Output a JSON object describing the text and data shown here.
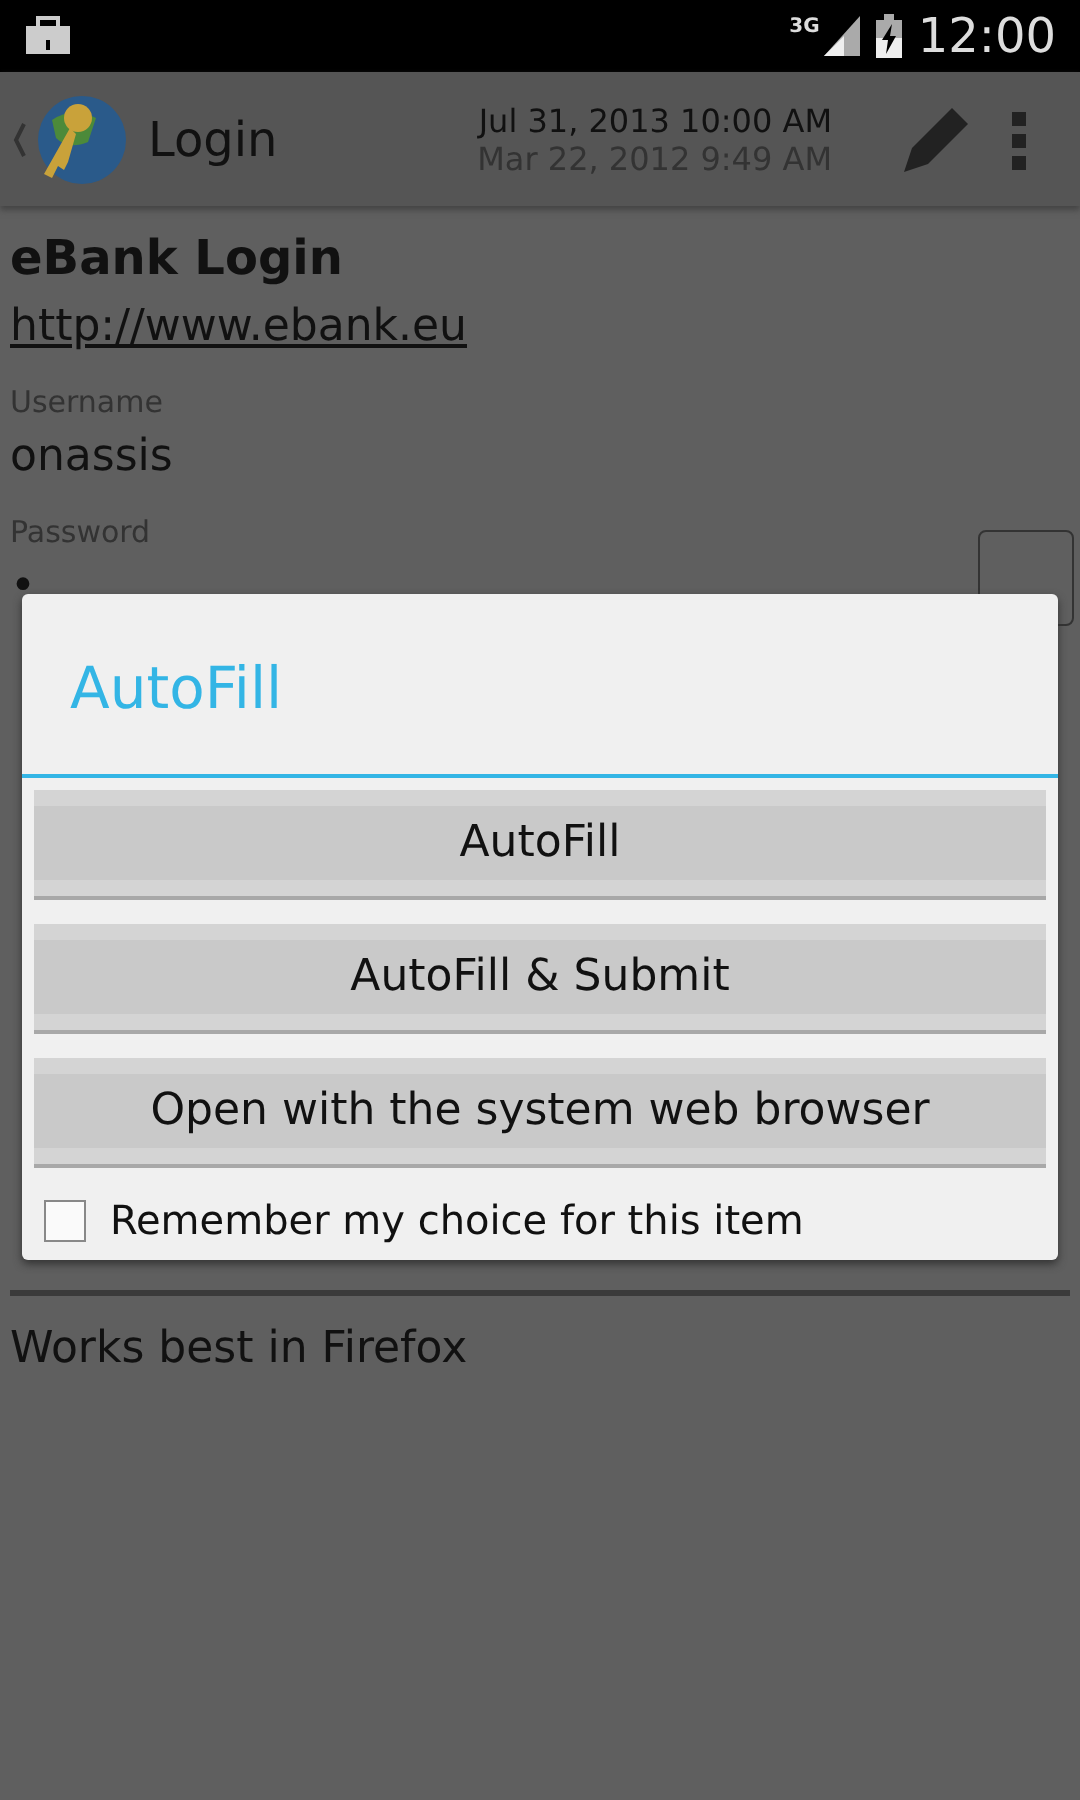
{
  "status_bar": {
    "time": "12:00",
    "network": "3G"
  },
  "action_bar": {
    "title": "Login",
    "modified": "Jul 31, 2013 10:00 AM",
    "created": "Mar 22, 2012 9:49 AM"
  },
  "entry": {
    "title": "eBank Login",
    "url": "http://www.ebank.eu",
    "fields": [
      {
        "label": "Username",
        "value": "onassis"
      },
      {
        "label": "Password",
        "value": "•"
      }
    ],
    "notes": "Works best in Firefox"
  },
  "dialog": {
    "title": "AutoFill",
    "buttons": [
      "AutoFill",
      "AutoFill & Submit",
      "Open with the system web browser"
    ],
    "remember": {
      "label": "Remember my choice for this item",
      "checked": false
    }
  }
}
